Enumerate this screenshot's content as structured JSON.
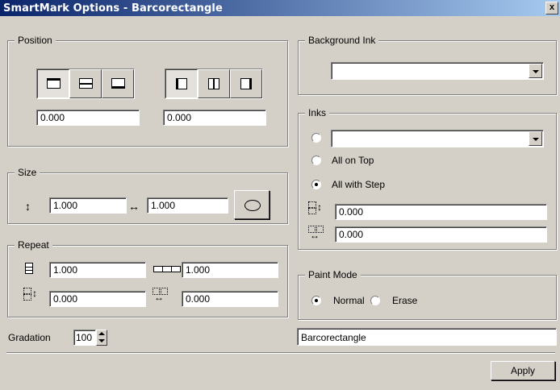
{
  "window": {
    "title": "SmartMark Options - Barcorectangle",
    "close": "x"
  },
  "position": {
    "legend": "Position",
    "value_vertical": "0.000",
    "value_horizontal": "0.000"
  },
  "size": {
    "legend": "Size",
    "height_value": "1.000",
    "width_value": "1.000"
  },
  "repeat": {
    "legend": "Repeat",
    "count_vertical": "1.000",
    "count_horizontal": "1.000",
    "step_vertical": "0.000",
    "step_horizontal": "0.000"
  },
  "gradation": {
    "label": "Gradation",
    "value": "100"
  },
  "background_ink": {
    "legend": "Background Ink",
    "selected": ""
  },
  "inks": {
    "legend": "Inks",
    "selected": "",
    "option_all_on_top": "All on Top",
    "option_all_with_step": "All with Step",
    "step_vertical": "0.000",
    "step_horizontal": "0.000"
  },
  "paint_mode": {
    "legend": "Paint Mode",
    "normal": "Normal",
    "erase": "Erase"
  },
  "name_field": "Barcorectangle",
  "apply": "Apply"
}
